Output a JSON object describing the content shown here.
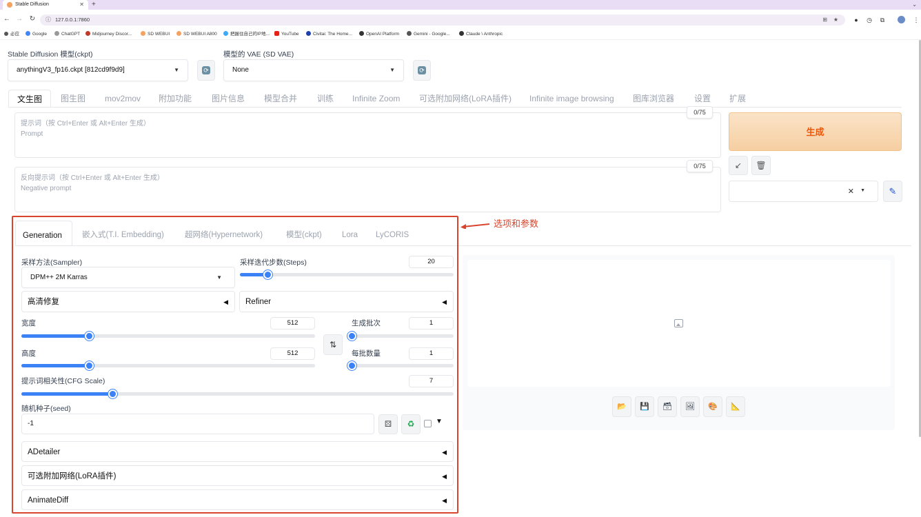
{
  "browser": {
    "tab_title": "Stable Diffusion",
    "url": "127.0.0.1:7860",
    "bookmarks": [
      {
        "label": "必应"
      },
      {
        "label": "Google"
      },
      {
        "label": "ChatGPT"
      },
      {
        "label": "Midjourney Discor..."
      },
      {
        "label": "SD WEBUI"
      },
      {
        "label": "SD WEBUI A800"
      },
      {
        "label": "把握住自己的IP地..."
      },
      {
        "label": "YouTube"
      },
      {
        "label": "Civitai: The Home..."
      },
      {
        "label": "OpenAI Platform"
      },
      {
        "label": "Gemini - Google..."
      },
      {
        "label": "Claude \\ Anthropic"
      }
    ]
  },
  "model": {
    "ckpt_label": "Stable Diffusion 模型(ckpt)",
    "ckpt_value": "anythingV3_fp16.ckpt [812cd9f9d9]",
    "vae_label": "模型的 VAE (SD VAE)",
    "vae_value": "None"
  },
  "main_tabs": [
    "文生图",
    "图生图",
    "mov2mov",
    "附加功能",
    "图片信息",
    "模型合并",
    "训练",
    "Infinite Zoom",
    "可选附加网络(LoRA插件)",
    "Infinite image browsing",
    "图库浏览器",
    "设置",
    "扩展"
  ],
  "prompt": {
    "placeholder_line1": "提示词（按 Ctrl+Enter 或 Alt+Enter 生成）",
    "placeholder_line2": "Prompt",
    "counter": "0/75"
  },
  "negative_prompt": {
    "placeholder_line1": "反向提示词（按 Ctrl+Enter 或 Alt+Enter 生成）",
    "placeholder_line2": "Negative prompt",
    "counter": "0/75"
  },
  "generate_label": "生成",
  "annotation": "选项和参数",
  "param_tabs": [
    "Generation",
    "嵌入式(T.I. Embedding)",
    "超网络(Hypernetwork)",
    "模型(ckpt)",
    "Lora",
    "LyCORIS"
  ],
  "sampler": {
    "label": "采样方法(Sampler)",
    "value": "DPM++ 2M Karras"
  },
  "steps": {
    "label": "采样迭代步数(Steps)",
    "value": "20",
    "fraction": 0.13
  },
  "hires_label": "高清修复",
  "refiner_label": "Refiner",
  "width": {
    "label": "宽度",
    "value": "512",
    "fraction": 0.23
  },
  "height": {
    "label": "高度",
    "value": "512",
    "fraction": 0.23
  },
  "batch_count": {
    "label": "生成批次",
    "value": "1",
    "fraction": 0.0
  },
  "batch_size": {
    "label": "每批数量",
    "value": "1",
    "fraction": 0.0
  },
  "cfg": {
    "label": "提示词相关性(CFG Scale)",
    "value": "7",
    "fraction": 0.21
  },
  "seed": {
    "label": "随机种子(seed)",
    "value": "-1"
  },
  "accordions": [
    "ADetailer",
    "可选附加网络(LoRA插件)",
    "AnimateDiff"
  ],
  "output_buttons": [
    "folder-icon",
    "save-icon",
    "zip-icon",
    "send-to-img2img-icon",
    "send-to-inpaint-icon",
    "send-to-extras-icon"
  ],
  "colors": {
    "accent": "#3b82f6",
    "generate": "#ea580c",
    "highlight": "#d9442c"
  }
}
